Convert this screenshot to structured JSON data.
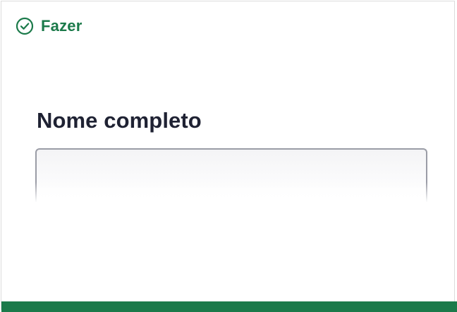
{
  "status": {
    "icon": "check-circle-icon",
    "label": "Fazer",
    "color": "#1b7a4a"
  },
  "form": {
    "name_field": {
      "label": "Nome completo",
      "value": "",
      "placeholder": ""
    }
  },
  "theme": {
    "accent": "#1b7a4a",
    "label_color": "#1f2233",
    "input_border": "#9a9ca6"
  }
}
